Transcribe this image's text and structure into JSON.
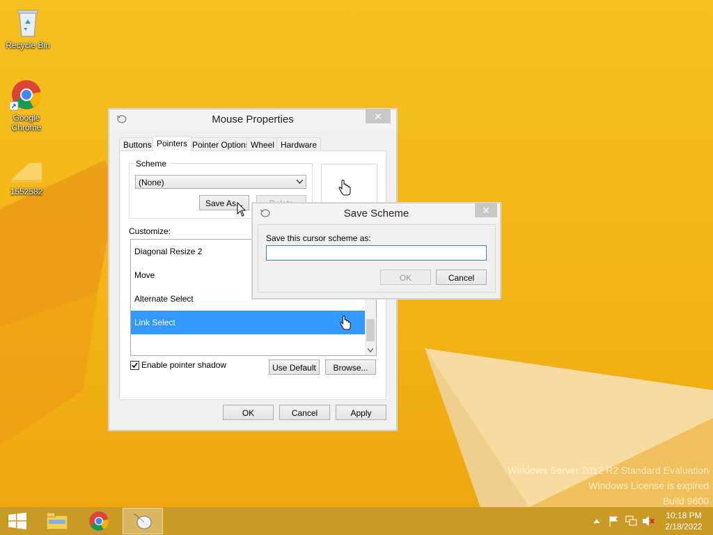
{
  "desktop": {
    "icons": [
      {
        "label": "Recycle Bin",
        "icon": "recycle-bin-icon"
      },
      {
        "label": "Google Chrome",
        "icon": "chrome-icon"
      },
      {
        "label": "1552582",
        "icon": "folder-icon"
      }
    ],
    "watermark": {
      "line1": "Windows Server 2012 R2 Standard Evaluation",
      "line2": "Windows License is expired",
      "line3": "Build 9600"
    }
  },
  "mouse_properties": {
    "title": "Mouse Properties",
    "close": "✕",
    "tabs": [
      "Buttons",
      "Pointers",
      "Pointer Options",
      "Wheel",
      "Hardware"
    ],
    "active_tab": "Pointers",
    "scheme_label": "Scheme",
    "scheme_value": "(None)",
    "save_as": "Save As...",
    "delete": "Delete",
    "customize_label": "Customize:",
    "pointers": [
      {
        "name": "Diagonal Resize 2",
        "selected": false
      },
      {
        "name": "Move",
        "selected": false
      },
      {
        "name": "Alternate Select",
        "selected": false
      },
      {
        "name": "Link Select",
        "selected": true
      }
    ],
    "enable_shadow": "Enable pointer shadow",
    "enable_shadow_checked": true,
    "use_default": "Use Default",
    "browse": "Browse...",
    "ok": "OK",
    "cancel": "Cancel",
    "apply": "Apply"
  },
  "save_scheme": {
    "title": "Save Scheme",
    "close": "✕",
    "prompt": "Save this cursor scheme as:",
    "input_value": "",
    "ok": "OK",
    "cancel": "Cancel"
  },
  "taskbar": {
    "time": "10:18 PM",
    "date": "2/18/2022",
    "apps": [
      "start-icon",
      "file-explorer-icon",
      "chrome-icon",
      "mouse-properties-icon"
    ]
  }
}
